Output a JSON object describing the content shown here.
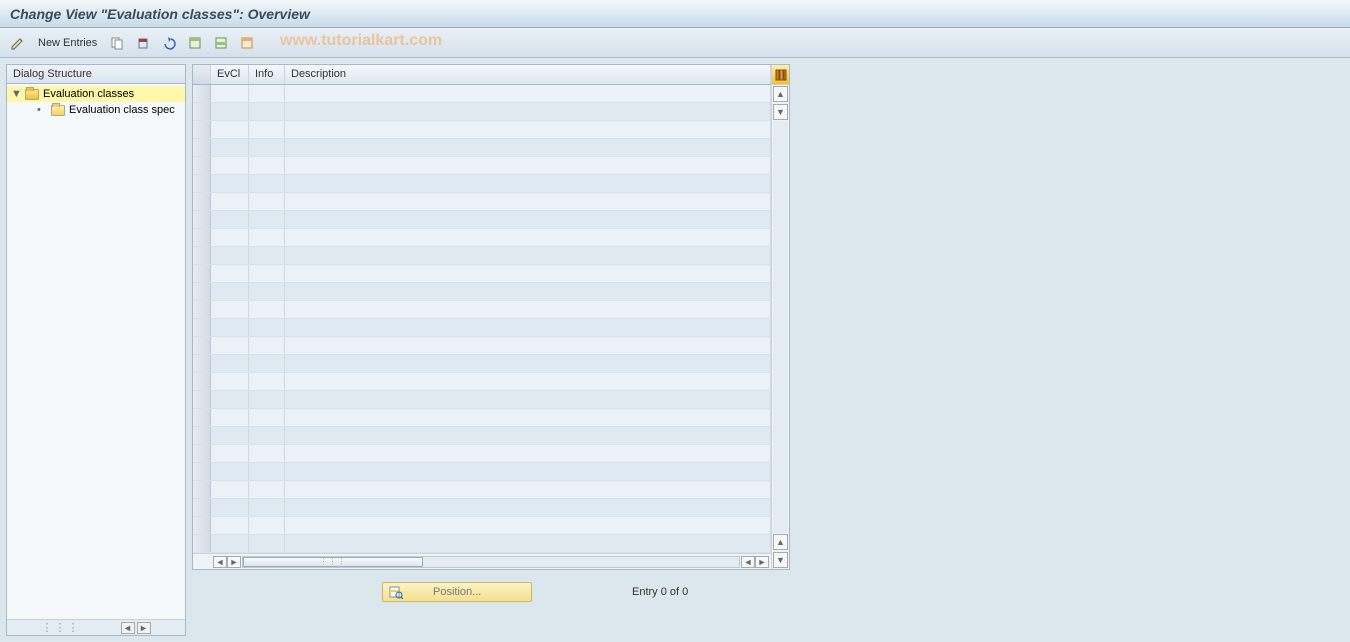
{
  "title": "Change View \"Evaluation classes\": Overview",
  "toolbar": {
    "new_entries_label": "New Entries"
  },
  "watermark": "www.tutorialkart.com",
  "dialog_structure": {
    "header": "Dialog Structure",
    "items": [
      {
        "label": "Evaluation classes",
        "selected": true
      },
      {
        "label": "Evaluation class spec",
        "selected": false
      }
    ]
  },
  "table": {
    "columns": {
      "evcl": "EvCl",
      "info": "Info",
      "description": "Description"
    },
    "rows": 26
  },
  "footer": {
    "position_label": "Position...",
    "entry_text": "Entry 0 of 0"
  }
}
